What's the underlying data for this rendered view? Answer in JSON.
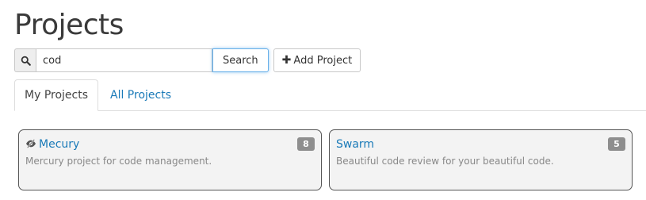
{
  "page": {
    "title": "Projects"
  },
  "search": {
    "icon": "search-icon",
    "value": "cod",
    "button_label": "Search"
  },
  "toolbar": {
    "add_label": "Add Project",
    "add_icon": "plus-icon"
  },
  "tabs": [
    {
      "label": "My Projects",
      "active": true
    },
    {
      "label": "All Projects",
      "active": false
    }
  ],
  "projects": [
    {
      "name": "Mecury",
      "description": "Mercury project for code management.",
      "count": "8",
      "icon": "eye-slash-icon"
    },
    {
      "name": "Swarm",
      "description": "Beautiful code review for your beautiful code.",
      "count": "5"
    }
  ],
  "colors": {
    "link": "#1a7ab8",
    "badge": "#8e8e8e",
    "focus": "#66afe9"
  }
}
